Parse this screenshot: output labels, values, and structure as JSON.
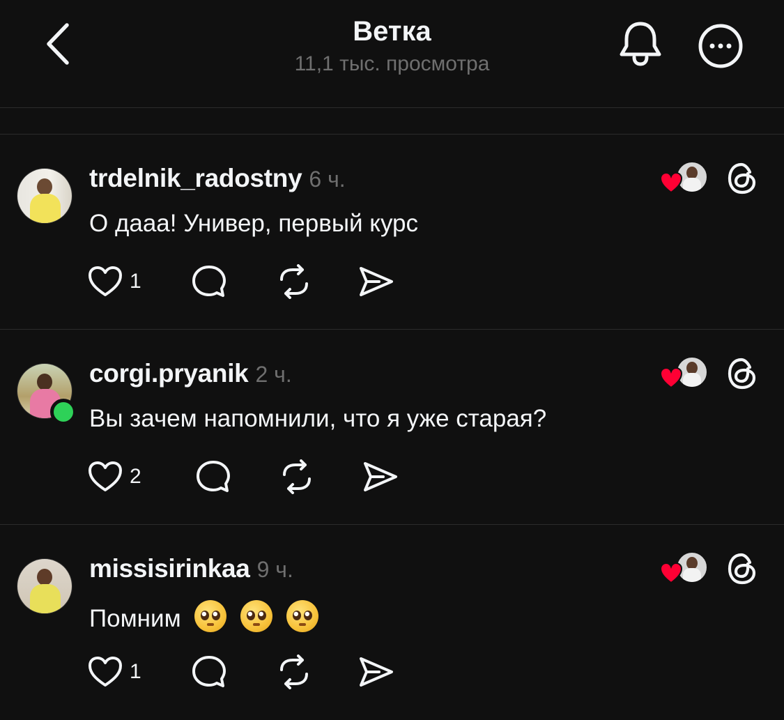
{
  "header": {
    "title": "Ветка",
    "subtitle": "11,1 тыс. просмотра",
    "back_icon": "chevron-left-icon",
    "bell_icon": "bell-icon",
    "more_icon": "more-horizontal-icon"
  },
  "posts": [
    {
      "username": "trdelnik_radostny",
      "time": "6 ч.",
      "text": "О дааа! Универ, первый курс",
      "emojis": [],
      "likes": "1",
      "online": false
    },
    {
      "username": "corgi.pryanik",
      "time": "2 ч.",
      "text": "Вы зачем напомнили, что я уже старая?",
      "emojis": [],
      "likes": "2",
      "online": true
    },
    {
      "username": "missisirinkaa",
      "time": "9 ч.",
      "text": "Помним",
      "emojis": [
        "🥺",
        "🥺",
        "🥺"
      ],
      "likes": "1",
      "online": false
    }
  ],
  "colors": {
    "background": "#101010",
    "text": "#f3f5f7",
    "muted": "#6f6f6f",
    "heart": "#ff0034",
    "online": "#2ed158"
  }
}
